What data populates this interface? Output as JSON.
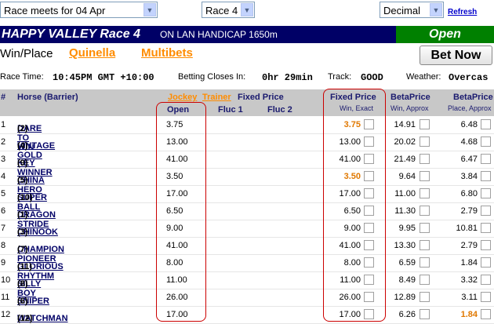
{
  "meeting_select": "Race meets for 04 Apr",
  "race_select": "Race 4",
  "odds_format_select": "Decimal",
  "refresh_label": "Refresh",
  "race_title": "HAPPY VALLEY Race 4",
  "race_subtitle": "ON LAN HANDICAP 1650m",
  "race_status": "Open",
  "nav": {
    "win_place": "Win/Place",
    "quinella": "Quinella",
    "multibets": "Multibets",
    "bet_now": "Bet Now"
  },
  "info": {
    "race_time_label": "Race Time:",
    "race_time": "10:45PM GMT +10:00",
    "closes_label": "Betting Closes In:",
    "closes": "0hr 29min",
    "track_label": "Track:",
    "track": "GOOD",
    "weather_label": "Weather:",
    "weather": "Overcas"
  },
  "headers": {
    "hash": "#",
    "horse": "Horse (Barrier)",
    "jockey": "Jockey",
    "trainer": "Trainer",
    "fixed_price": "Fixed Price",
    "open": "Open",
    "fluc1": "Fluc 1",
    "fluc2": "Fluc 2",
    "fixed_price_col": "Fixed Price",
    "fixed_price_sub": "Win, Exact",
    "beta_win": "BetaPrice",
    "beta_win_sub": "Win, Approx",
    "beta_place": "BetaPrice",
    "beta_place_sub": "Place, Approx"
  },
  "runners": [
    {
      "num": "1",
      "name": "DARE TO WIN",
      "barrier": "(2)",
      "open": "3.75",
      "fixed": "3.75",
      "fixed_hl": true,
      "beta_win": "14.91",
      "beta_place": "6.48",
      "place_hl": false
    },
    {
      "num": "2",
      "name": "VINTAGE GOLD",
      "barrier": "(4)",
      "open": "13.00",
      "fixed": "13.00",
      "fixed_hl": false,
      "beta_win": "20.02",
      "beta_place": "4.68",
      "place_hl": false
    },
    {
      "num": "3",
      "name": "KEY WINNER",
      "barrier": "(9)",
      "open": "41.00",
      "fixed": "41.00",
      "fixed_hl": false,
      "beta_win": "21.49",
      "beta_place": "6.47",
      "place_hl": false
    },
    {
      "num": "4",
      "name": "CHINA HERO",
      "barrier": "(5)",
      "open": "3.50",
      "fixed": "3.50",
      "fixed_hl": true,
      "beta_win": "9.64",
      "beta_place": "3.84",
      "place_hl": false
    },
    {
      "num": "5",
      "name": "SUPER BALL",
      "barrier": "(10)",
      "open": "17.00",
      "fixed": "17.00",
      "fixed_hl": false,
      "beta_win": "11.00",
      "beta_place": "6.80",
      "place_hl": false
    },
    {
      "num": "6",
      "name": "DRAGON STRIDE",
      "barrier": "(1)",
      "open": "6.50",
      "fixed": "6.50",
      "fixed_hl": false,
      "beta_win": "11.30",
      "beta_place": "2.79",
      "place_hl": false
    },
    {
      "num": "7",
      "name": "CHINOOK",
      "barrier": "(3)",
      "open": "9.00",
      "fixed": "9.00",
      "fixed_hl": false,
      "beta_win": "9.95",
      "beta_place": "10.81",
      "place_hl": false
    },
    {
      "num": "8",
      "name": "CHAMPION PIONEER",
      "barrier": "(7)",
      "open": "41.00",
      "fixed": "41.00",
      "fixed_hl": false,
      "beta_win": "13.30",
      "beta_place": "2.79",
      "place_hl": false
    },
    {
      "num": "9",
      "name": "GLORIOUS RHYTHM",
      "barrier": "(11)",
      "open": "8.00",
      "fixed": "8.00",
      "fixed_hl": false,
      "beta_win": "6.59",
      "beta_place": "1.84",
      "place_hl": false
    },
    {
      "num": "10",
      "name": "SILLY BOY",
      "barrier": "(8)",
      "open": "11.00",
      "fixed": "11.00",
      "fixed_hl": false,
      "beta_win": "8.49",
      "beta_place": "3.32",
      "place_hl": false
    },
    {
      "num": "11",
      "name": "SNIPER",
      "barrier": "(6)",
      "open": "26.00",
      "fixed": "26.00",
      "fixed_hl": false,
      "beta_win": "12.89",
      "beta_place": "3.11",
      "place_hl": false
    },
    {
      "num": "12",
      "name": "WATCHMAN",
      "barrier": "(12)",
      "open": "17.00",
      "fixed": "17.00",
      "fixed_hl": false,
      "beta_win": "6.26",
      "beta_place": "1.84",
      "place_hl": true
    }
  ],
  "colors": {
    "header_bg": "#000066",
    "status_bg": "#008000",
    "highlight": "#e07800",
    "link": "#ff8c00",
    "annotation": "#cc0000"
  }
}
